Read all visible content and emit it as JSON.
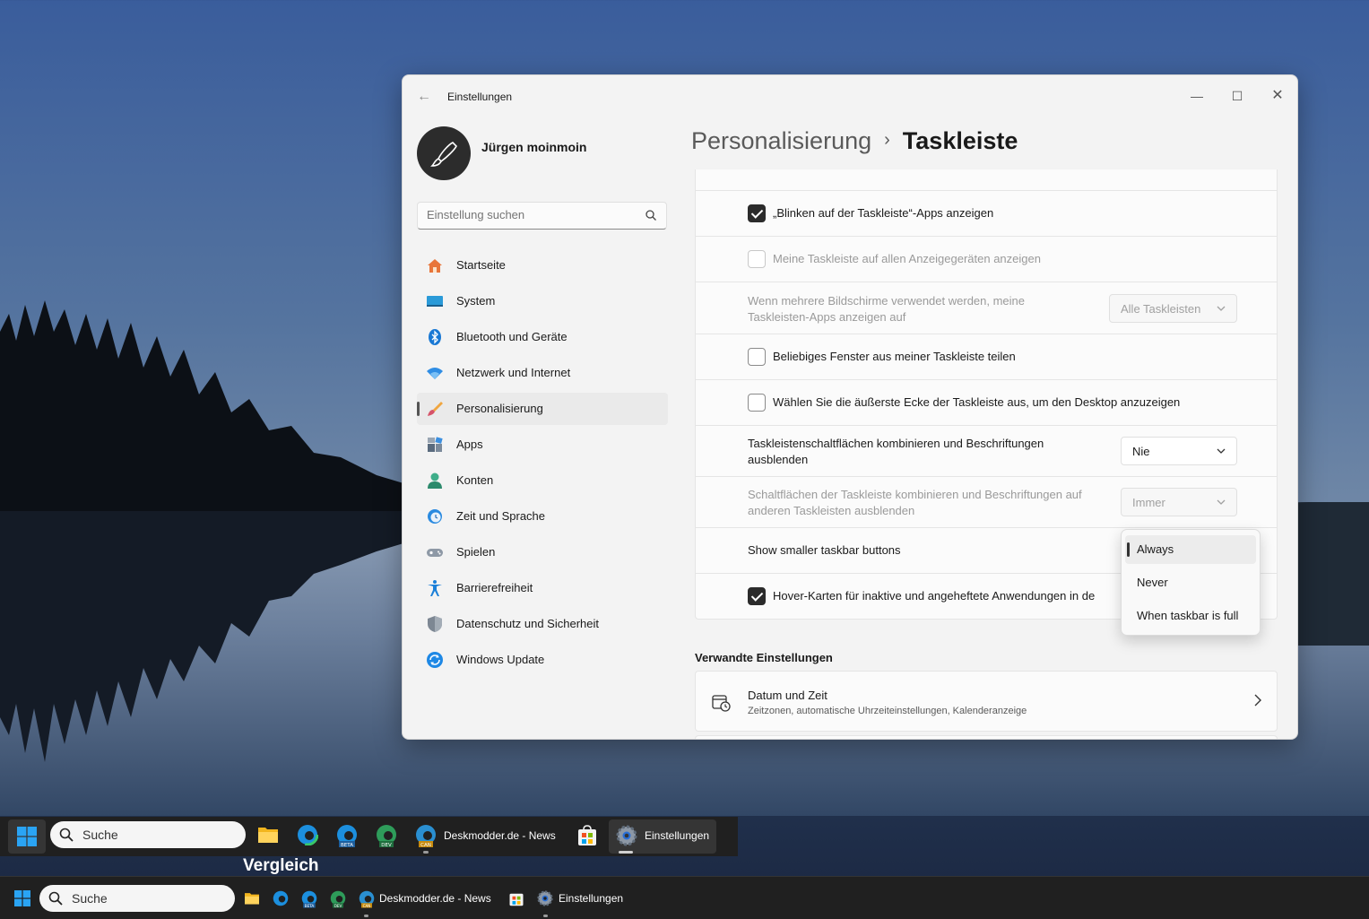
{
  "window": {
    "title": "Einstellungen",
    "minimize_icon": "—",
    "maximize_icon": "☐",
    "close_icon": "✕",
    "back_icon": "←"
  },
  "user": {
    "name": "Jürgen moinmoin"
  },
  "search": {
    "placeholder": "Einstellung suchen"
  },
  "sidebar": {
    "items": [
      {
        "label": "Startseite",
        "icon": "home-icon"
      },
      {
        "label": "System",
        "icon": "monitor-icon"
      },
      {
        "label": "Bluetooth und Geräte",
        "icon": "bluetooth-icon"
      },
      {
        "label": "Netzwerk und Internet",
        "icon": "wifi-icon"
      },
      {
        "label": "Personalisierung",
        "icon": "brush-icon",
        "active": true
      },
      {
        "label": "Apps",
        "icon": "apps-icon"
      },
      {
        "label": "Konten",
        "icon": "person-icon"
      },
      {
        "label": "Zeit und Sprache",
        "icon": "clock-globe-icon"
      },
      {
        "label": "Spielen",
        "icon": "gamepad-icon"
      },
      {
        "label": "Barrierefreiheit",
        "icon": "accessibility-icon"
      },
      {
        "label": "Datenschutz und Sicherheit",
        "icon": "shield-icon"
      },
      {
        "label": "Windows Update",
        "icon": "update-icon"
      }
    ]
  },
  "breadcrumb": {
    "parent": "Personalisierung",
    "separator": "›",
    "current": "Taskleiste"
  },
  "settings": {
    "blink": {
      "label": "„Blinken auf der Taskleiste“-Apps anzeigen",
      "checked": true
    },
    "all_displays": {
      "label": "Meine Taskleiste auf allen Anzeigegeräten anzeigen",
      "checked": false,
      "disabled": true
    },
    "multi_monitor": {
      "label": "Wenn mehrere Bildschirme verwendet werden, meine Taskleisten-Apps anzeigen auf",
      "value": "Alle Taskleisten",
      "disabled": true
    },
    "share_window": {
      "label": "Beliebiges Fenster aus meiner Taskleiste teilen",
      "checked": false
    },
    "far_corner": {
      "label": "Wählen Sie die äußerste Ecke der Taskleiste aus, um den Desktop anzuzeigen",
      "checked": false
    },
    "combine": {
      "label": "Taskleistenschaltflächen kombinieren und Beschriftungen ausblenden",
      "value": "Nie"
    },
    "combine_other": {
      "label": "Schaltflächen der Taskleiste kombinieren und Beschriftungen auf anderen Taskleisten ausblenden",
      "value": "Immer",
      "disabled": true
    },
    "smaller_buttons": {
      "label": "Show smaller taskbar buttons"
    },
    "hover_cards": {
      "label": "Hover-Karten für inaktive und angeheftete Anwendungen in de",
      "checked": true
    }
  },
  "flyout": {
    "options": [
      "Always",
      "Never",
      "When taskbar is full"
    ],
    "selected": "Always"
  },
  "related": {
    "title": "Verwandte Einstellungen",
    "items": [
      {
        "title": "Datum und Zeit",
        "subtitle": "Zeitzonen, automatische Uhrzeiteinstellungen, Kalenderanzeige",
        "icon": "calendar-clock-icon"
      }
    ]
  },
  "taskbar_new": {
    "search_label": "Suche",
    "apps": [
      {
        "name": "file-explorer-icon"
      },
      {
        "name": "edge-icon"
      },
      {
        "name": "edge-beta-icon",
        "badge": "BETA"
      },
      {
        "name": "edge-dev-icon",
        "badge": "DEV"
      },
      {
        "name": "edge-canary-icon",
        "badge": "CAN",
        "label": "Deskmodder.de - News"
      },
      {
        "name": "store-icon"
      },
      {
        "name": "settings-icon",
        "label": "Einstellungen"
      }
    ]
  },
  "comparison_label": "Vergleich",
  "taskbar_old": {
    "search_label": "Suche",
    "apps": [
      {
        "name": "file-explorer-icon"
      },
      {
        "name": "edge-icon"
      },
      {
        "name": "edge-beta-icon",
        "badge": "BETA"
      },
      {
        "name": "edge-dev-icon",
        "badge": "DEV"
      },
      {
        "name": "edge-canary-icon",
        "badge": "CAN",
        "label": "Deskmodder.de - News"
      },
      {
        "name": "store-icon"
      },
      {
        "name": "settings-icon",
        "label": "Einstellungen"
      }
    ]
  },
  "colors": {
    "accent": "#0067c0",
    "taskbar": "#202020",
    "window_bg": "#f3f3f3"
  }
}
